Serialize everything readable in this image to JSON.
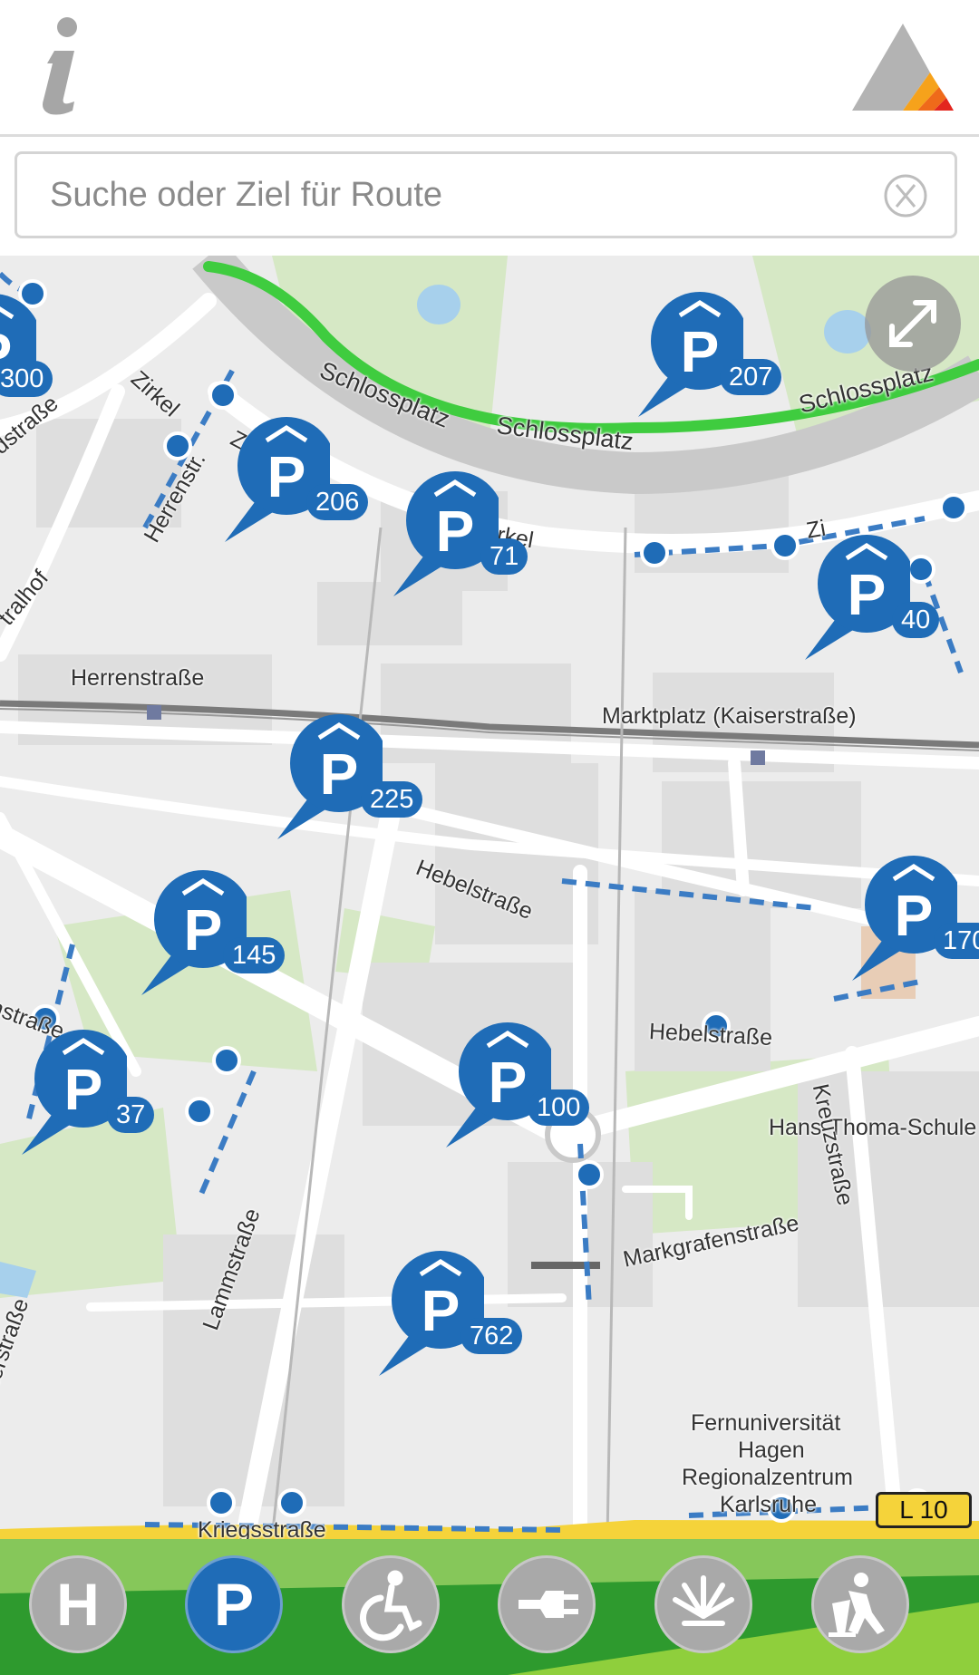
{
  "search": {
    "placeholder": "Suche oder Ziel für Route"
  },
  "colors": {
    "accent": "#1f6cb7",
    "route": "#3fcc3f",
    "bar_green": "#2e9a2e",
    "bar_light": "#8fcf3c",
    "button_grey": "#a9a9a9"
  },
  "map": {
    "labels": {
      "schlossplatz_1": "Schlossplatz",
      "schlossplatz_2": "Schlossplatz",
      "schlossplatz_3": "Schlossplatz",
      "zirkel_1": "Zirkel",
      "zirkel_2": "Zirkel",
      "zirkel_3": "Zirkel",
      "zirkel_4": "Zi",
      "herrenstrasse_1": "Herrenstraße",
      "herrenstrasse_2": "Herrenstr.",
      "marktplatz": "Marktplatz (Kaiserstraße)",
      "hebelstrasse_1": "Hebelstraße",
      "hebelstrasse_2": "Hebelstraße",
      "hans_thoma": "Hans-Thoma-Schule",
      "markgrafenstrasse": "Markgrafenstraße",
      "kreuzstrasse": "Kreuzstraße",
      "lammstrasse": "Lammstraße",
      "ritterstrasse": "Ritterstraße",
      "kriegsstrasse": "Kriegsstraße",
      "fernuni_1": "Fernuniversität",
      "fernuni_2": "Hagen",
      "fernuni_3": "Regionalzentrum",
      "fernuni_4": "Karlsruhe",
      "edge_west_1": "dstraße",
      "edge_west_2": "tralhof",
      "edge_west_3": "nstraße",
      "road_sign": "L 10"
    },
    "parking": [
      {
        "id": "p207",
        "count": "207"
      },
      {
        "id": "p206",
        "count": "206"
      },
      {
        "id": "p71",
        "count": "71"
      },
      {
        "id": "p40",
        "count": "40"
      },
      {
        "id": "p225",
        "count": "225"
      },
      {
        "id": "p145",
        "count": "145"
      },
      {
        "id": "p170",
        "count": "170"
      },
      {
        "id": "p37",
        "count": "37"
      },
      {
        "id": "p100",
        "count": "100"
      },
      {
        "id": "p762",
        "count": "762"
      },
      {
        "id": "p300",
        "count": "300"
      }
    ]
  },
  "categories": [
    {
      "id": "hotel",
      "icon": "hotel-h-icon",
      "label": "H"
    },
    {
      "id": "parking",
      "icon": "parking-p-icon",
      "label": "P",
      "active": true
    },
    {
      "id": "accessible",
      "icon": "wheelchair-icon"
    },
    {
      "id": "charging",
      "icon": "ev-plug-icon"
    },
    {
      "id": "events",
      "icon": "fan-icon"
    },
    {
      "id": "construction",
      "icon": "construction-worker-icon"
    }
  ]
}
